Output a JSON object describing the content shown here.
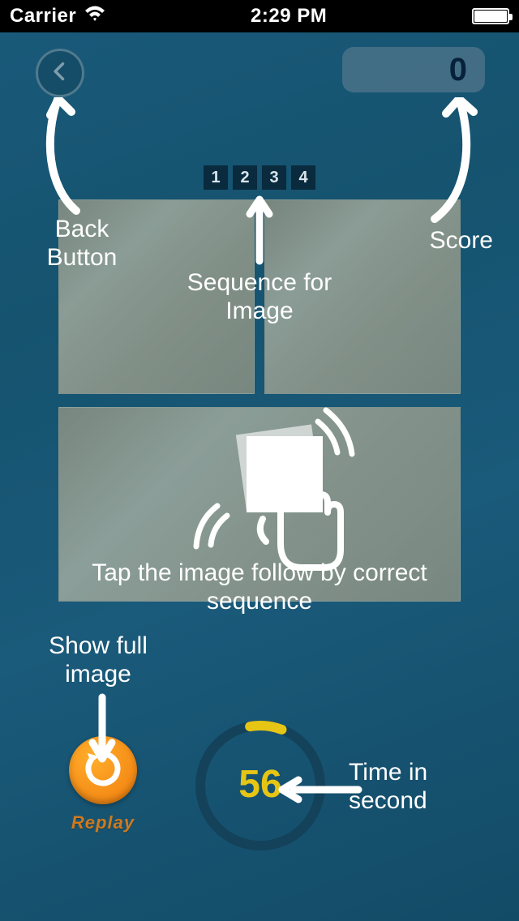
{
  "status_bar": {
    "carrier": "Carrier",
    "time": "2:29 PM"
  },
  "game": {
    "score": "0",
    "sequence": [
      "1",
      "2",
      "3",
      "4"
    ],
    "timer_seconds": "56"
  },
  "replay": {
    "label": "Replay"
  },
  "tutorial": {
    "back_label": "Back Button",
    "score_label": "Score",
    "sequence_label": "Sequence for Image",
    "instruction": "Tap the image follow by correct sequence",
    "show_full_label": "Show full image",
    "time_label": "Time in second"
  },
  "icons": {
    "back": "chevron-left-icon",
    "wifi": "wifi-icon",
    "battery": "battery-icon",
    "replay": "refresh-icon",
    "tap": "tap-hand-icon"
  }
}
